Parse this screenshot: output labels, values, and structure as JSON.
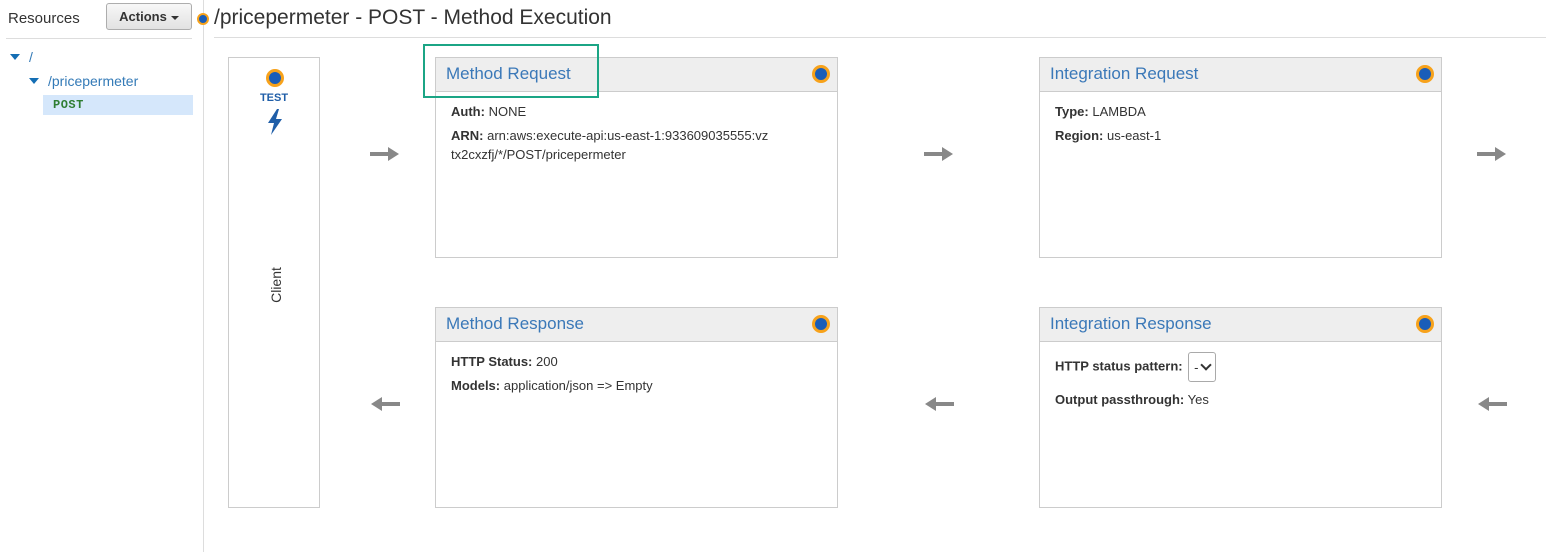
{
  "sidebar": {
    "title": "Resources",
    "actions_label": "Actions",
    "tree": {
      "root": "/",
      "resource": "/pricepermeter",
      "method": "POST"
    }
  },
  "page_title": "/pricepermeter - POST - Method Execution",
  "client": {
    "test_label": "TEST",
    "label": "Client"
  },
  "method_request": {
    "title": "Method Request",
    "auth_label": "Auth:",
    "auth_value": "NONE",
    "arn_label": "ARN:",
    "arn_value": "arn:aws:execute-api:us-east-1:933609035555:vztx2cxzfj/*/POST/pricepermeter"
  },
  "integration_request": {
    "title": "Integration Request",
    "type_label": "Type:",
    "type_value": "LAMBDA",
    "region_label": "Region:",
    "region_value": "us-east-1"
  },
  "method_response": {
    "title": "Method Response",
    "status_label": "HTTP Status:",
    "status_value": "200",
    "models_label": "Models:",
    "models_value": "application/json => Empty"
  },
  "integration_response": {
    "title": "Integration Response",
    "pattern_label": "HTTP status pattern:",
    "pattern_value": "-",
    "passthrough_label": "Output passthrough:",
    "passthrough_value": "Yes"
  },
  "colors": {
    "link": "#3a78b8",
    "dot_fill": "#1a5db8",
    "dot_ring": "#f7a21b",
    "highlight": "#1ba585",
    "arrow": "#888888"
  }
}
